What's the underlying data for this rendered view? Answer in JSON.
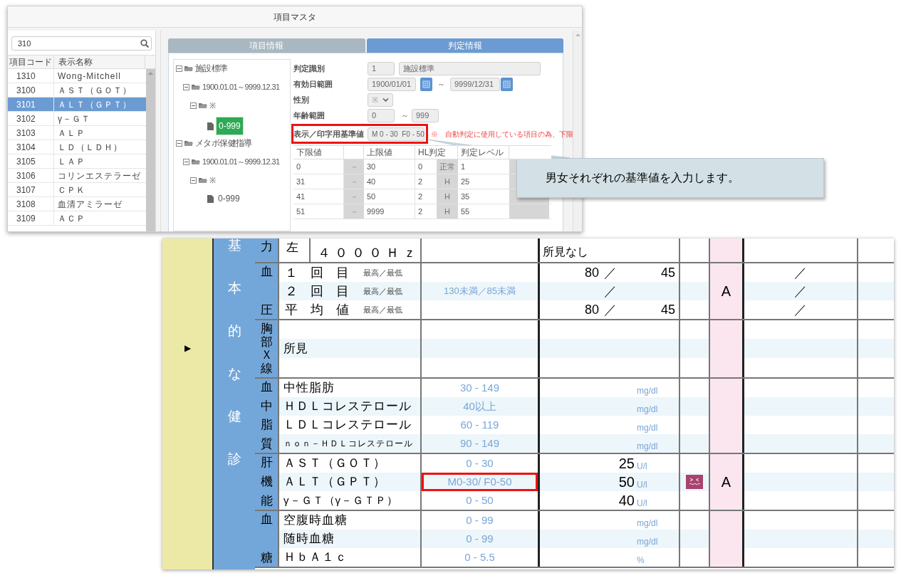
{
  "master_window": {
    "title": "項目マスタ",
    "search": {
      "value": "310"
    },
    "list": {
      "columns": [
        "項目コード",
        "表示名称"
      ],
      "rows": [
        {
          "code": "1310",
          "name": "Wong-Mitchell",
          "selected": false
        },
        {
          "code": "3100",
          "name": "ＡＳＴ（ＧＯＴ）",
          "selected": false
        },
        {
          "code": "3101",
          "name": "ＡＬＴ（ＧＰＴ）",
          "selected": true
        },
        {
          "code": "3102",
          "name": "γ－ＧＴ",
          "selected": false
        },
        {
          "code": "3103",
          "name": "ＡＬＰ",
          "selected": false
        },
        {
          "code": "3104",
          "name": "ＬＤ（ＬＤＨ）",
          "selected": false
        },
        {
          "code": "3105",
          "name": "ＬＡＰ",
          "selected": false
        },
        {
          "code": "3106",
          "name": "コリンエステラーゼ",
          "selected": false
        },
        {
          "code": "3107",
          "name": "ＣＰＫ",
          "selected": false
        },
        {
          "code": "3108",
          "name": "血清アミラーゼ",
          "selected": false
        },
        {
          "code": "3109",
          "name": "ＡＣＰ",
          "selected": false
        }
      ]
    },
    "tabs": [
      {
        "label": "項目情報",
        "selected": false
      },
      {
        "label": "判定情報",
        "selected": true
      }
    ],
    "tree": [
      {
        "label": "施設標準",
        "kind": "folder",
        "expanded": true,
        "children": [
          {
            "label": "1900.01.01～9999.12.31",
            "kind": "folder",
            "expanded": true,
            "children": [
              {
                "label": "※",
                "kind": "folder",
                "expanded": true,
                "children": [
                  {
                    "label": "0-999",
                    "kind": "file",
                    "selected": true
                  }
                ]
              }
            ]
          }
        ]
      },
      {
        "label": "メタボ保健指導",
        "kind": "folder",
        "expanded": true,
        "children": [
          {
            "label": "1900.01.01～9999.12.31",
            "kind": "folder",
            "expanded": true,
            "children": [
              {
                "label": "※",
                "kind": "folder",
                "expanded": true,
                "children": [
                  {
                    "label": "0-999",
                    "kind": "file",
                    "selected": false
                  }
                ]
              }
            ]
          }
        ]
      }
    ],
    "form": [
      {
        "kind": "id",
        "label": "判定識別",
        "values": [
          "1",
          "施設標準"
        ],
        "highlighted": false
      },
      {
        "kind": "date_range",
        "label": "有効日範囲",
        "from": "1900/01/01",
        "sep": "～",
        "to": "9999/12/31",
        "highlighted": false
      },
      {
        "kind": "select",
        "label": "性別",
        "value": "※",
        "highlighted": false
      },
      {
        "kind": "range",
        "label": "年齢範囲",
        "from": "0",
        "sep": "～",
        "to": "999",
        "highlighted": false
      },
      {
        "kind": "reference",
        "label": "表示／印字用基準値",
        "value": "M 0 - 30  F0 - 50",
        "note": "※　自動判定に使用している項目の為、下限",
        "highlighted": true
      }
    ],
    "table": {
      "columns": [
        "下限値",
        "上限値",
        "HL判定",
        "判定レベル"
      ],
      "rows": [
        {
          "low": "0",
          "dash": "－",
          "high": "30",
          "hl": "0",
          "hl_label": "正常",
          "level": "1"
        },
        {
          "low": "31",
          "dash": "－",
          "high": "40",
          "hl": "2",
          "hl_label": "H",
          "level": "25"
        },
        {
          "low": "41",
          "dash": "－",
          "high": "50",
          "hl": "2",
          "hl_label": "H",
          "level": "35"
        },
        {
          "low": "51",
          "dash": "－",
          "high": "9999",
          "hl": "2",
          "hl_label": "H",
          "level": "55"
        }
      ]
    }
  },
  "callout": {
    "text": "男女それぞれの基準値を入力します。"
  },
  "sheet": {
    "expand_marker": "▶",
    "category": "基本的な健診",
    "groups": [
      {
        "kind": "hearing",
        "label": "力",
        "rows": [
          {
            "side": "左",
            "item": "４０００Ｈｚ",
            "result": "所見なし"
          }
        ]
      },
      {
        "kind": "pressure",
        "label": "血圧",
        "grade": "A",
        "rows": [
          {
            "item": "１　回　目",
            "sub": "最高／最低",
            "high": "80",
            "sep": "／",
            "low": "45",
            "prev_sep": "／"
          },
          {
            "item": "２　回　目",
            "sub": "最高／最低",
            "reference": "130未満／85未満",
            "sep": "／",
            "prev_sep": "／"
          },
          {
            "item": "平　均　値",
            "sub": "最高／最低",
            "high": "80",
            "sep": "／",
            "low": "45",
            "prev_sep": "／"
          }
        ]
      },
      {
        "kind": "finding",
        "label": "胸部Ｘ線",
        "rows": [
          {
            "item": "所見"
          }
        ]
      },
      {
        "kind": "lab",
        "label": "血中脂質",
        "rows": [
          {
            "item": "中性脂肪",
            "reference": "30 - 149",
            "unit": "mg/dl",
            "flag": false,
            "highlighted": false
          },
          {
            "item": "ＨＤＬコレステロール",
            "reference": "40以上",
            "unit": "mg/dl",
            "flag": false,
            "highlighted": false
          },
          {
            "item": "ＬＤＬコレステロール",
            "reference": "60 - 119",
            "unit": "mg/dl",
            "flag": false,
            "highlighted": false
          },
          {
            "item": "ｎｏｎ－ＨＤＬコレステロール",
            "reference": "90 - 149",
            "unit": "mg/dl",
            "flag": false,
            "highlighted": false
          }
        ]
      },
      {
        "kind": "lab",
        "label": "肝機能",
        "grade": "A",
        "rows": [
          {
            "item": "ＡＳＴ（ＧＯＴ）",
            "reference": "0 - 30",
            "value": "25",
            "unit": "U/l",
            "flag": false,
            "highlighted": false
          },
          {
            "item": "ＡＬＴ（ＧＰＴ）",
            "reference": "M0-30/ F0-50",
            "value": "50",
            "unit": "U/l",
            "flag": true,
            "highlighted": true
          },
          {
            "item": "γ－ＧＴ（γ－ＧＴＰ）",
            "reference": "0 - 50",
            "value": "40",
            "unit": "U/l",
            "flag": false,
            "highlighted": false
          }
        ]
      },
      {
        "kind": "lab",
        "label": "血糖",
        "rows": [
          {
            "item": "空腹時血糖",
            "reference": "0 - 99",
            "unit": "mg/dl",
            "flag": false,
            "highlighted": false
          },
          {
            "item": "随時血糖",
            "reference": "0 - 99",
            "unit": "mg/dl",
            "flag": false,
            "highlighted": false
          },
          {
            "item": "ＨｂＡ１ｃ",
            "reference": "0 - 5.5",
            "unit": "%",
            "flag": false,
            "highlighted": false
          }
        ]
      }
    ]
  }
}
